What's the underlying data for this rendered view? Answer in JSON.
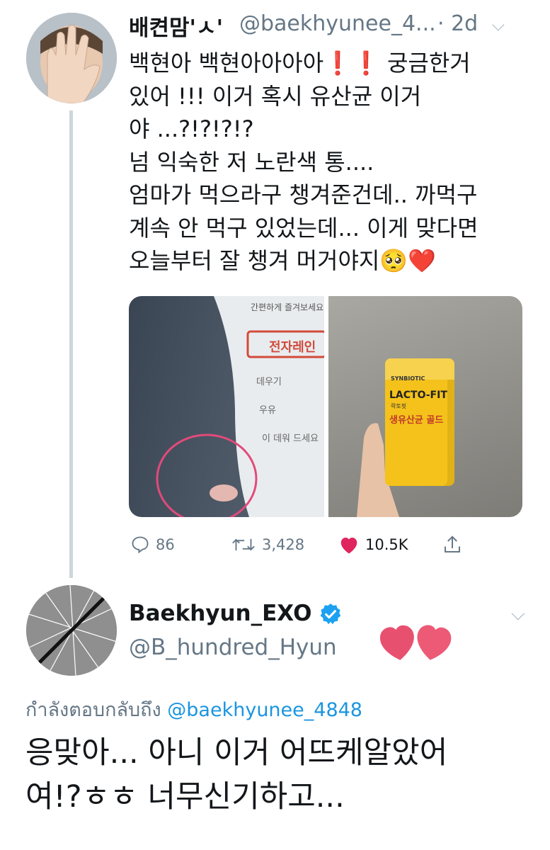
{
  "tweet1": {
    "display_name": "배켠맘'ㅅ'",
    "handle": "@baekhyunee_4...",
    "time": "· 2d",
    "text": "백현아 백현아아아아❗️❗️ 궁금한거\n있어 !!! 이거 혹시 유산균 이거\n야 ...?!?!?!?\n넘 익숙한 저 노란색 통....\n엄마가 먹으라구 챙겨준건데.. 까먹구\n계속 안 먹구 있었는데... 이게 맞다면\n오늘부터 잘 챙겨 머거야지🥺❤️",
    "media": {
      "left_photo_text": [
        "간편하게 즐겨보세요",
        "전자레인",
        "데우기",
        "우유",
        "이 데워 드세요"
      ],
      "right_photo_text": {
        "brand_top": "SYNBIOTIC",
        "brand": "LACTO-FIT",
        "brand_sub": "락토핏",
        "product": "생유산균 골드"
      }
    },
    "actions": {
      "replies": "86",
      "retweets": "3,428",
      "likes": "10.5K"
    },
    "colors": {
      "like": "#e0245e",
      "muted": "#657786",
      "thread": "#ccd6dd"
    },
    "icons": [
      "reply-icon",
      "retweet-icon",
      "heart-icon",
      "share-icon",
      "chevron-down-icon"
    ]
  },
  "tweet2": {
    "display_name": "Baekhyun_EXO",
    "handle": "@B_hundred_Hyun",
    "replying_label": "กำลังตอบกลับถึง",
    "replying_to": "@baekhyunee_4848",
    "text": "응맞아... 아니 이거 어뜨케알았어\n여!?ㅎㅎ 너무신기하고...",
    "colors": {
      "verified": "#1da1f2",
      "mention": "#1b95e0",
      "hearts": "#e8506f"
    },
    "icons": [
      "verified-badge-icon",
      "chevron-down-icon",
      "hearts-sticker-icon"
    ]
  }
}
